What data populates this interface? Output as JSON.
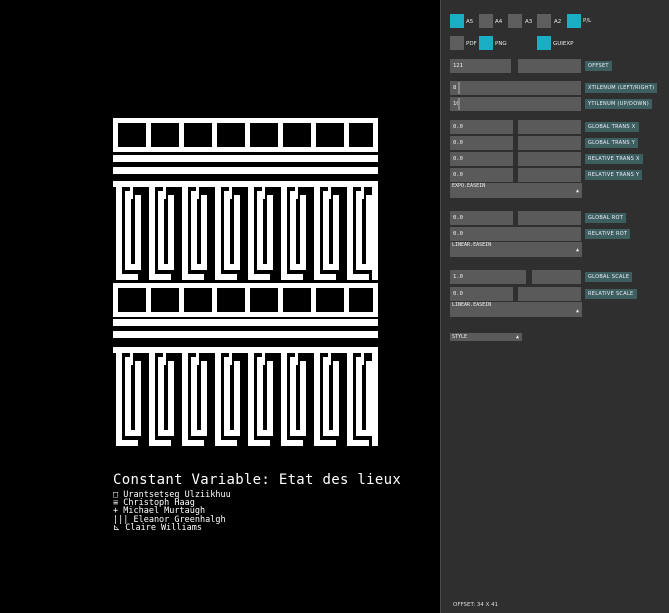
{
  "colors": {
    "accent": "#1aaec4",
    "panel": "#2f2f2f",
    "field": "#5a5a5a",
    "label": "#3e5f5f",
    "pattern": "#ffffff"
  },
  "credits": {
    "title": "Constant Variable: Etat des lieux",
    "names": [
      "□ Urantsetseg Ulziikhuu",
      "≡ Christoph Haag",
      "+ Michael Murtaugh",
      "||| Eleanor Greenhalgh",
      "⊾ Claire Williams"
    ]
  },
  "panel": {
    "format_buttons": [
      {
        "label": "A5",
        "active": true
      },
      {
        "label": "A4",
        "active": false
      },
      {
        "label": "A3",
        "active": false
      },
      {
        "label": "A2",
        "active": false
      },
      {
        "label": "P/L",
        "active": true
      }
    ],
    "export_buttons": [
      {
        "label": "PDF",
        "active": false
      },
      {
        "label": "PNG",
        "active": true
      },
      {
        "label": "GUIEXP",
        "active": true
      }
    ],
    "offset": {
      "value": "121",
      "label": "OFFSET"
    },
    "xtilenum": {
      "value": "8",
      "label": "XTILENUM  (LEFT/RIGHT)"
    },
    "ytilenum": {
      "value": "10",
      "label": "YTILENUM  (UP/DOWN)"
    },
    "global_trans_x": {
      "value": "0.0",
      "label": "GLOBAL TRANS X"
    },
    "global_trans_y": {
      "value": "0.0",
      "label": "GLOBAL TRANS Y"
    },
    "relative_trans_x": {
      "value": "0.0",
      "label": "RELATIVE TRANS X"
    },
    "relative_trans_y": {
      "value": "0.0",
      "label": "RELATIVE TRANS Y"
    },
    "trans_easing": "EXPO.EASEIN",
    "global_rot": {
      "value": "0.0",
      "label": "GLOBAL ROT"
    },
    "relative_rot": {
      "value": "0.0",
      "label": "RELATIVE ROT"
    },
    "rot_easing": "LINEAR.EASEIN",
    "global_scale": {
      "value": "1.0",
      "label": "GLOBAL SCALE"
    },
    "relative_scale": {
      "value": "0.0",
      "label": "RELATIVE SCALE"
    },
    "scale_easing": "LINEAR.EASEIN",
    "style": "STYLE",
    "status": "OFFSET: 34 X 41"
  }
}
